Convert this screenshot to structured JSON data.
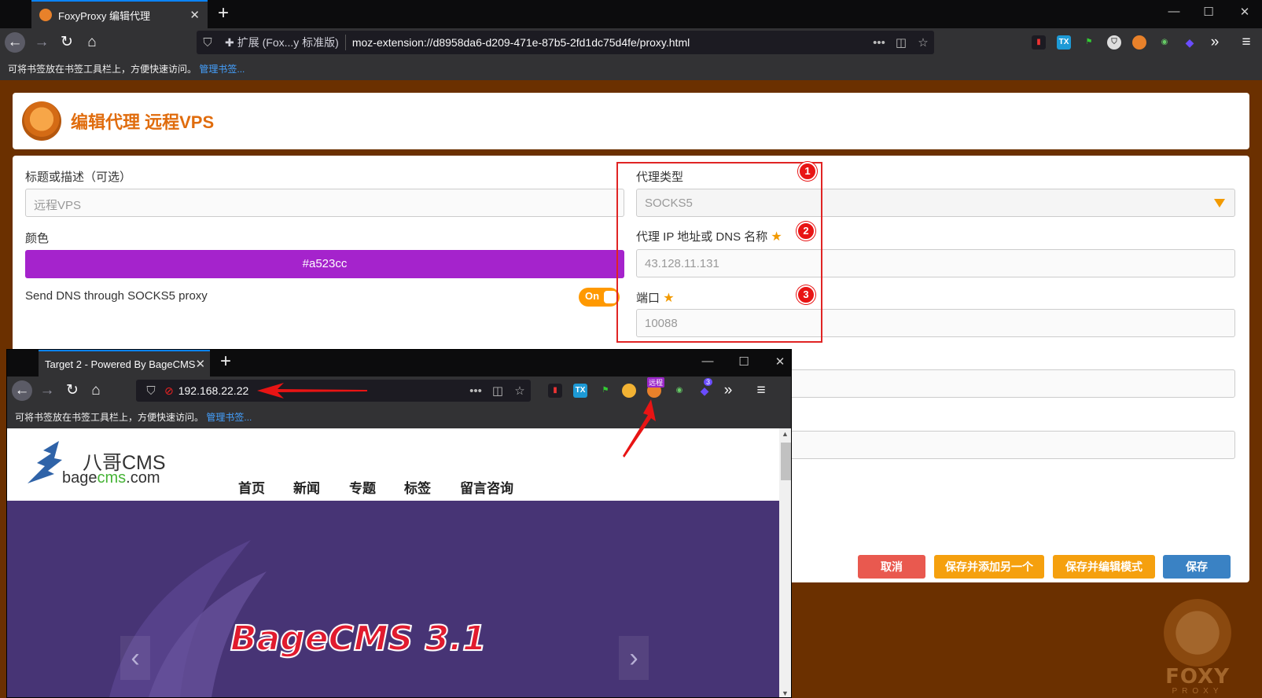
{
  "browser": {
    "tab_title": "FoxyProxy 编辑代理",
    "url_identity": "扩展 (Fox...y 标准版)",
    "url": "moz-extension://d8958da6-d209-471e-87b5-2fd1dc75d4fe/proxy.html",
    "bookmarks_hint": "可将书签放在书签工具栏上，方便快速访问。",
    "bookmarks_manage": "管理书签...",
    "accent": "#0a84ff"
  },
  "header": {
    "title": "编辑代理 远程VPS",
    "title_color": "#e06c0d"
  },
  "form": {
    "title_label": "标题或描述（可选）",
    "title_value": "远程VPS",
    "color_label": "颜色",
    "color_value": "#a523cc",
    "dns_label": "Send DNS through SOCKS5 proxy",
    "dns_toggle": "On",
    "type_label": "代理类型",
    "type_value": "SOCKS5",
    "host_label": "代理 IP 地址或 DNS 名称",
    "host_value": "43.128.11.131",
    "port_label": "端口",
    "port_value": "10088",
    "annotations": [
      "1",
      "2",
      "3"
    ]
  },
  "buttons": {
    "cancel": "取消",
    "save_add": "保存并添加另一个",
    "save_edit": "保存并编辑模式",
    "save": "保存"
  },
  "watermark": {
    "text": "FOXY",
    "sub": "PROXY"
  },
  "inner_window": {
    "tab_title": "Target 2 - Powered By BageCMS",
    "url": "192.168.22.22",
    "ext_badge": "远程",
    "ext_count": "3",
    "bookmarks_hint": "可将书签放在书签工具栏上，方便快速访问。",
    "bookmarks_manage": "管理书签...",
    "site": {
      "logo_cn": "八哥CMS",
      "logo_en_a": "bage",
      "logo_en_b": "cms",
      "logo_en_c": ".com",
      "nav": [
        "首页",
        "新闻",
        "专题",
        "标签",
        "留言咨询"
      ],
      "hero_title": "BageCMS 3.1"
    }
  }
}
